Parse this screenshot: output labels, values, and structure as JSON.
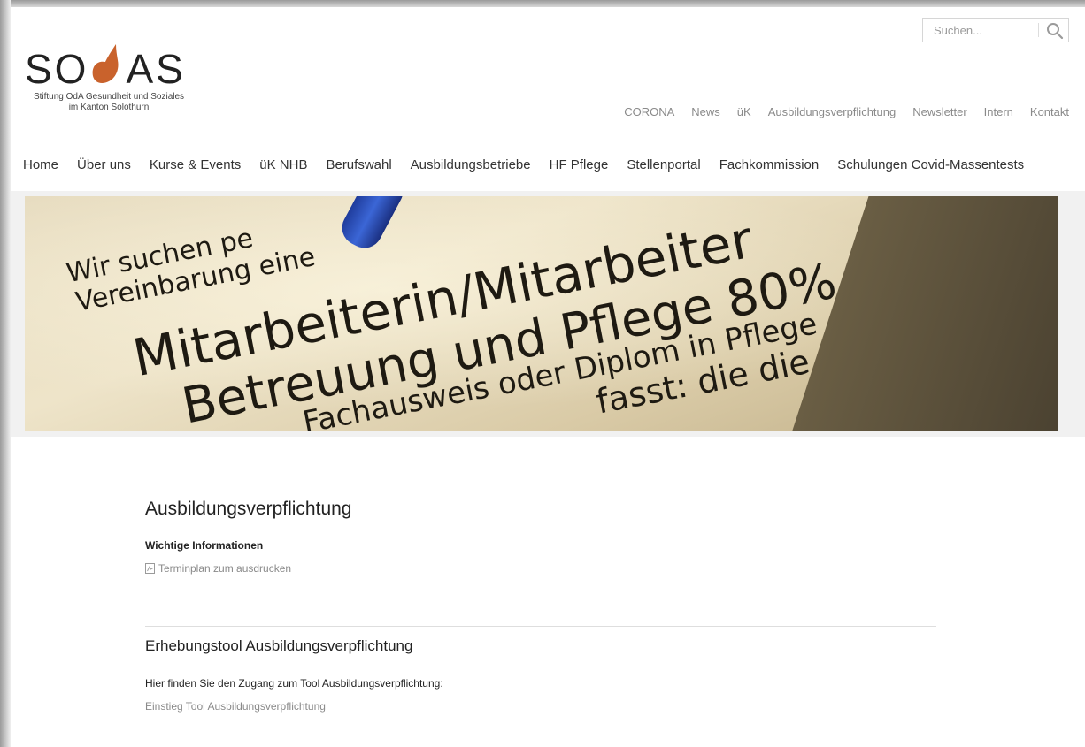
{
  "brand": {
    "logo_word_left": "SO",
    "logo_word_right": "AS",
    "logo_sub_line1": "Stiftung OdA Gesundheit und Soziales",
    "logo_sub_line2": "im Kanton Solothurn",
    "accent": "#c9622c"
  },
  "search": {
    "placeholder": "Suchen...",
    "icon": "search-icon"
  },
  "top_nav": [
    "CORONA",
    "News",
    "üK",
    "Ausbildungsverpflichtung",
    "Newsletter",
    "Intern",
    "Kontakt"
  ],
  "main_nav": [
    "Home",
    "Über uns",
    "Kurse & Events",
    "üK NHB",
    "Berufswahl",
    "Ausbildungsbetriebe",
    "HF Pflege",
    "Stellenportal",
    "Fachkommission",
    "Schulungen Covid-Massentests"
  ],
  "hero": {
    "line1": "Wir suchen pe",
    "line2": "Vereinbarung eine",
    "line3": "Mitarbeiterin/Mitarbeiter",
    "line4": "Betreuung und Pflege 80%",
    "line5": "Fachausweis oder Diplom in Pflege",
    "line6": "fasst:     die die"
  },
  "content": {
    "title": "Ausbildungsverpflichtung",
    "subtitle": "Wichtige Informationen",
    "pdf_link": "Terminplan zum ausdrucken",
    "section_title": "Erhebungstool Ausbildungsverpflichtung",
    "paragraph": "Hier finden Sie den Zugang zum Tool Ausbildungsverpflichtung:",
    "tool_link": "Einstieg Tool Ausbildungsverpflichtung"
  }
}
